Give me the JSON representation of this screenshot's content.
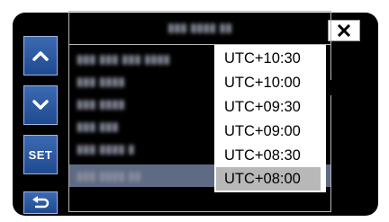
{
  "controls": {
    "up": "up",
    "down": "down",
    "set_label": "SET",
    "back": "back",
    "close": "close"
  },
  "panel": {
    "title": "▮▮▮ ▮▮▮▮ ▮▮",
    "rows": [
      "▮▮▮ ▮▮▮ ▮▮▮ ▮▮▮▮",
      "▮▮▮ ▮▮▮▮",
      "▮▮▮ ▮▮▮▮",
      "▮▮▮ ▮▮▮",
      "▮▮▮ ▮▮▮▮ ▮",
      "▮▮▮ ▮▮▮▮ ▮▮"
    ],
    "selected_row_index": 5
  },
  "timezone_dropdown": {
    "options": [
      "UTC+10:30",
      "UTC+10:00",
      "UTC+09:30",
      "UTC+09:00",
      "UTC+08:30",
      "UTC+08:00"
    ],
    "selected": "UTC+08:00"
  },
  "colors": {
    "button_blue": "#2b5aa3",
    "selection_gray": "#b8b8b8",
    "row_selected": "#5f6b85"
  }
}
